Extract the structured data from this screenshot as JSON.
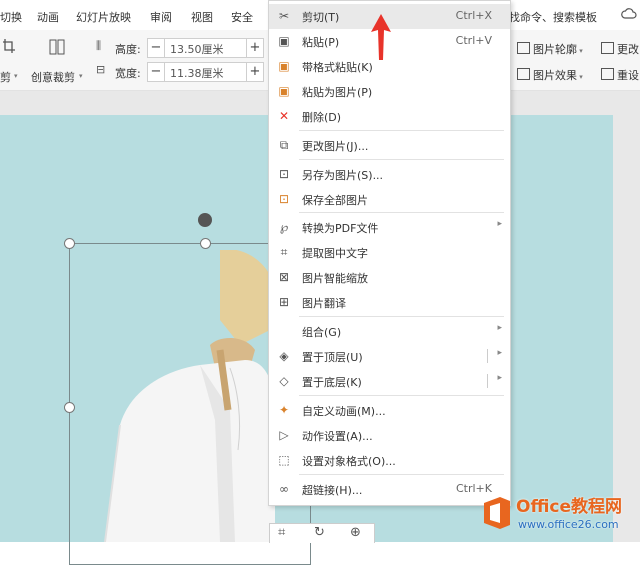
{
  "menubar": {
    "tabs": [
      "切换",
      "动画",
      "幻灯片放映",
      "审阅",
      "视图",
      "安全"
    ],
    "search_text": "找命令、搜索模板"
  },
  "toolbar": {
    "crop_label": "剪",
    "creative_crop_label": "创意裁剪",
    "height_label": "高度:",
    "height_value": "13.50厘米",
    "width_label": "宽度:",
    "width_value": "11.38厘米",
    "right_buttons": [
      "图片轮廓",
      "更改",
      "图片效果",
      "重设"
    ]
  },
  "context_menu": {
    "items": [
      {
        "icon": "scissors-icon",
        "label": "剪切(T)",
        "shortcut": "Ctrl+X",
        "highlighted": true
      },
      {
        "icon": "paste-icon",
        "label": "粘贴(P)",
        "shortcut": "Ctrl+V"
      },
      {
        "icon": "paste-format-icon",
        "label": "带格式粘贴(K)"
      },
      {
        "icon": "paste-image-icon",
        "label": "粘贴为图片(P)"
      },
      {
        "icon": "delete-icon",
        "label": "删除(D)"
      },
      {
        "icon": "change-image-icon",
        "label": "更改图片(J)..."
      },
      {
        "icon": "save-image-icon",
        "label": "另存为图片(S)..."
      },
      {
        "icon": "save-all-icon",
        "label": "保存全部图片"
      },
      {
        "icon": "pdf-icon",
        "label": "转换为PDF文件"
      },
      {
        "icon": "ocr-icon",
        "label": "提取图中文字"
      },
      {
        "icon": "smart-zoom-icon",
        "label": "图片智能缩放"
      },
      {
        "icon": "translate-icon",
        "label": "图片翻译"
      },
      {
        "icon": "none",
        "label": "组合(G)"
      },
      {
        "icon": "bring-front-icon",
        "label": "置于顶层(U)"
      },
      {
        "icon": "send-back-icon",
        "label": "置于底层(K)"
      },
      {
        "icon": "custom-animation-icon",
        "label": "自定义动画(M)..."
      },
      {
        "icon": "action-icon",
        "label": "动作设置(A)..."
      },
      {
        "icon": "format-object-icon",
        "label": "设置对象格式(O)..."
      },
      {
        "icon": "hyperlink-icon",
        "label": "超链接(H)...",
        "shortcut": "Ctrl+K"
      }
    ]
  },
  "watermark": {
    "title": "Office教程网",
    "url": "www.office26.com"
  },
  "colors": {
    "slide_bg": "#b7dde0",
    "accent_red": "#e8332a",
    "watermark_orange": "#e8661f",
    "watermark_blue": "#2a6fc0"
  }
}
